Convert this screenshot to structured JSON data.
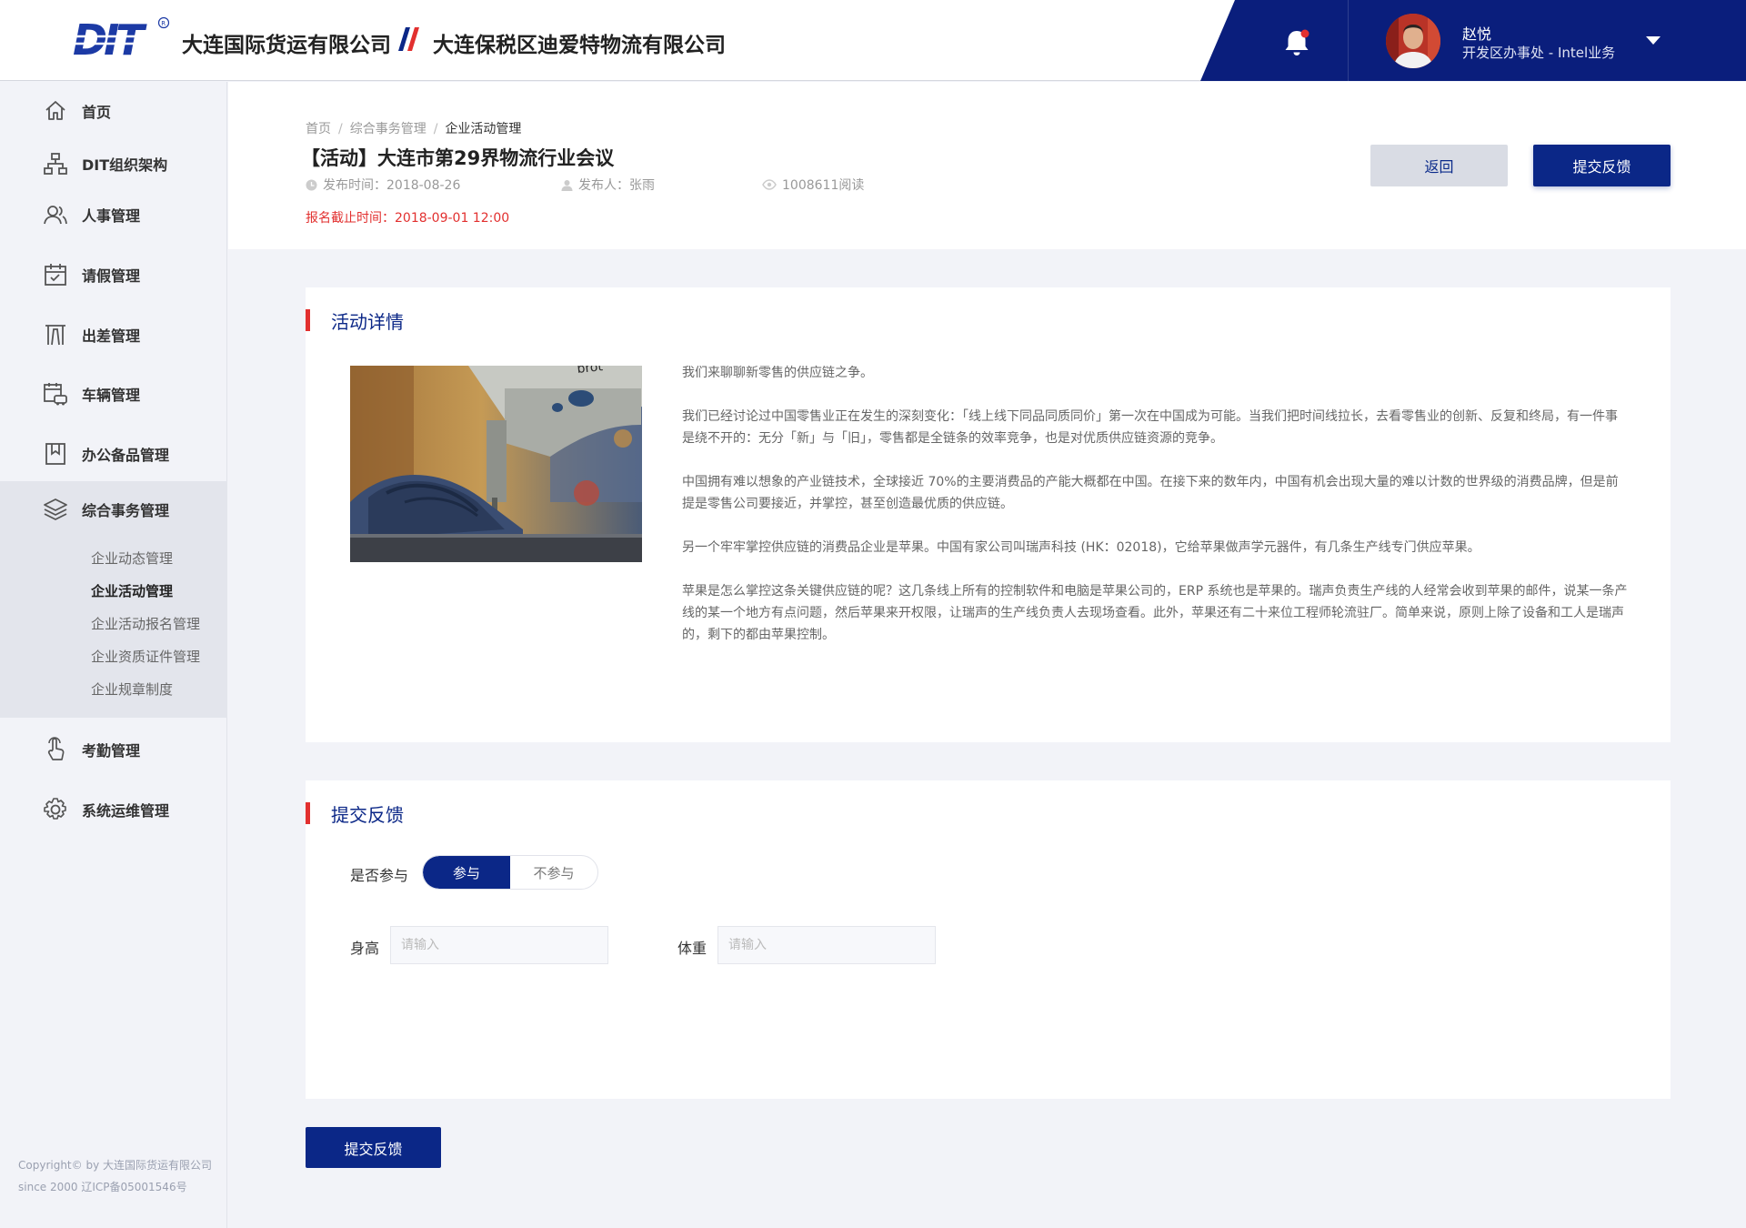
{
  "header": {
    "company_1": "大连国际货运有限公司",
    "company_2": "大连保税区迪爱特物流有限公司",
    "user_name": "赵悦",
    "user_dept": "开发区办事处 - Intel业务",
    "accent_color": "#0a1e7c",
    "notification_dot": "#e2302f"
  },
  "sidebar": {
    "items": [
      {
        "label": "首页",
        "icon": "home-icon"
      },
      {
        "label": "DIT组织架构",
        "icon": "org-chart-icon"
      },
      {
        "label": "人事管理",
        "icon": "people-icon"
      },
      {
        "label": "请假管理",
        "icon": "calendar-check-icon"
      },
      {
        "label": "出差管理",
        "icon": "gate-icon"
      },
      {
        "label": "车辆管理",
        "icon": "vehicle-icon"
      },
      {
        "label": "办公备品管理",
        "icon": "bookmark-icon"
      },
      {
        "label": "综合事务管理",
        "icon": "layers-icon"
      },
      {
        "label": "考勤管理",
        "icon": "hand-pointer-icon"
      },
      {
        "label": "系统运维管理",
        "icon": "gear-icon"
      }
    ],
    "sub_items": [
      {
        "label": "企业动态管理"
      },
      {
        "label": "企业活动管理"
      },
      {
        "label": "企业活动报名管理"
      },
      {
        "label": "企业资质证件管理"
      },
      {
        "label": "企业规章制度"
      }
    ],
    "copyright_line1": "Copyright© by 大连国际货运有限公司",
    "copyright_line2": "since 2000 辽ICP备05001546号"
  },
  "breadcrumb": {
    "home": "首页",
    "section": "综合事务管理",
    "current": "企业活动管理"
  },
  "page": {
    "title": "【活动】大连市第29界物流行业会议",
    "publish_time": "发布时间：2018-08-26",
    "publisher": "发布人：张雨",
    "reads": "1008611阅读",
    "deadline": "报名截止时间：2018-09-01 12:00",
    "back_label": "返回",
    "submit_label": "提交反馈"
  },
  "detail": {
    "title": "活动详情",
    "paragraphs": [
      "我们来聊聊新零售的供应链之争。",
      "我们已经讨论过中国零售业正在发生的深刻变化：「线上线下同品同质同价」第一次在中国成为可能。当我们把时间线拉长，去看零售业的创新、反复和终局，有一件事是绕不开的：无分「新」与「旧」，零售都是全链条的效率竞争，也是对优质供应链资源的竞争。",
      "中国拥有难以想象的产业链技术，全球接近 70%的主要消费品的产能大概都在中国。在接下来的数年内，中国有机会出现大量的难以计数的世界级的消费品牌，但是前提是零售公司要接近，并掌控，甚至创造最优质的供应链。",
      "另一个牢牢掌控供应链的消费品企业是苹果。中国有家公司叫瑞声科技 (HK：02018)，它给苹果做声学元器件，有几条生产线专门供应苹果。",
      "苹果是怎么掌控这条关键供应链的呢？这几条线上所有的控制软件和电脑是苹果公司的，ERP 系统也是苹果的。瑞声负责生产线的人经常会收到苹果的邮件，说某一条产线的某一个地方有点问题，然后苹果来开权限，让瑞声的生产线负责人去现场查看。此外，苹果还有二十来位工程师轮流驻厂。简单来说，原则上除了设备和工人是瑞声的，剩下的都由苹果控制。"
    ]
  },
  "feedback": {
    "title": "提交反馈",
    "participate_label": "是否参与",
    "option_yes": "参与",
    "option_no": "不参与",
    "height_label": "身高",
    "height_placeholder": "请输入",
    "weight_label": "体重",
    "weight_placeholder": "请输入",
    "submit_label": "提交反馈"
  }
}
